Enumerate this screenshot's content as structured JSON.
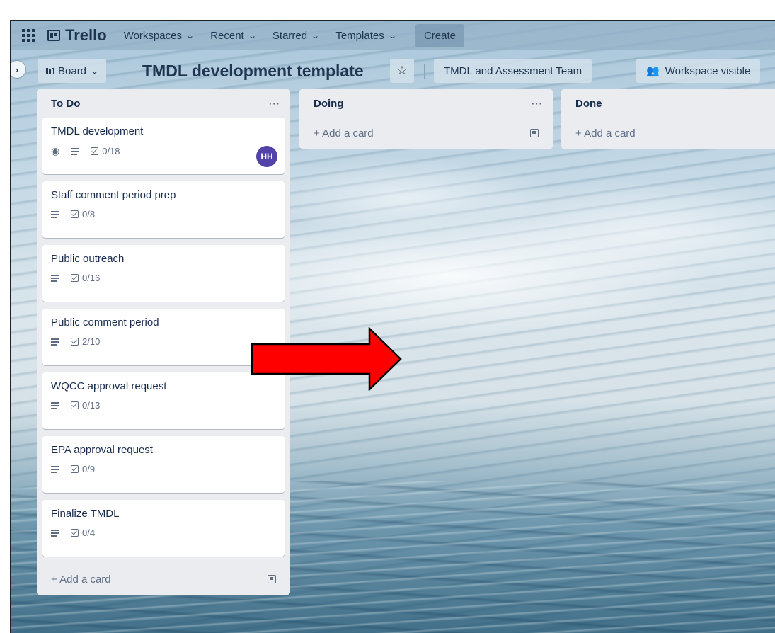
{
  "topnav": {
    "logo": "Trello",
    "items": [
      "Workspaces",
      "Recent",
      "Starred",
      "Templates"
    ],
    "create": "Create"
  },
  "board": {
    "view_switch": "Board",
    "title": "TMDL development template",
    "team": "TMDL and Assessment Team",
    "visibility": "Workspace visible"
  },
  "lists": [
    {
      "name": "To Do",
      "cards": [
        {
          "title": "TMDL development",
          "checklist": "0/18",
          "watch": true,
          "member": "HH"
        },
        {
          "title": "Staff comment period prep",
          "checklist": "0/8"
        },
        {
          "title": "Public outreach",
          "checklist": "0/16"
        },
        {
          "title": "Public comment period",
          "checklist": "2/10"
        },
        {
          "title": "WQCC approval request",
          "checklist": "0/13"
        },
        {
          "title": "EPA approval request",
          "checklist": "0/9"
        },
        {
          "title": "Finalize TMDL",
          "checklist": "0/4"
        }
      ],
      "add_card": "+ Add a card"
    },
    {
      "name": "Doing",
      "cards": [],
      "add_card": "+ Add a card"
    },
    {
      "name": "Done",
      "cards": [],
      "add_card": "+ Add a card"
    }
  ],
  "colors": {
    "arrow": "#ff0000",
    "avatar": "#5243aa"
  }
}
